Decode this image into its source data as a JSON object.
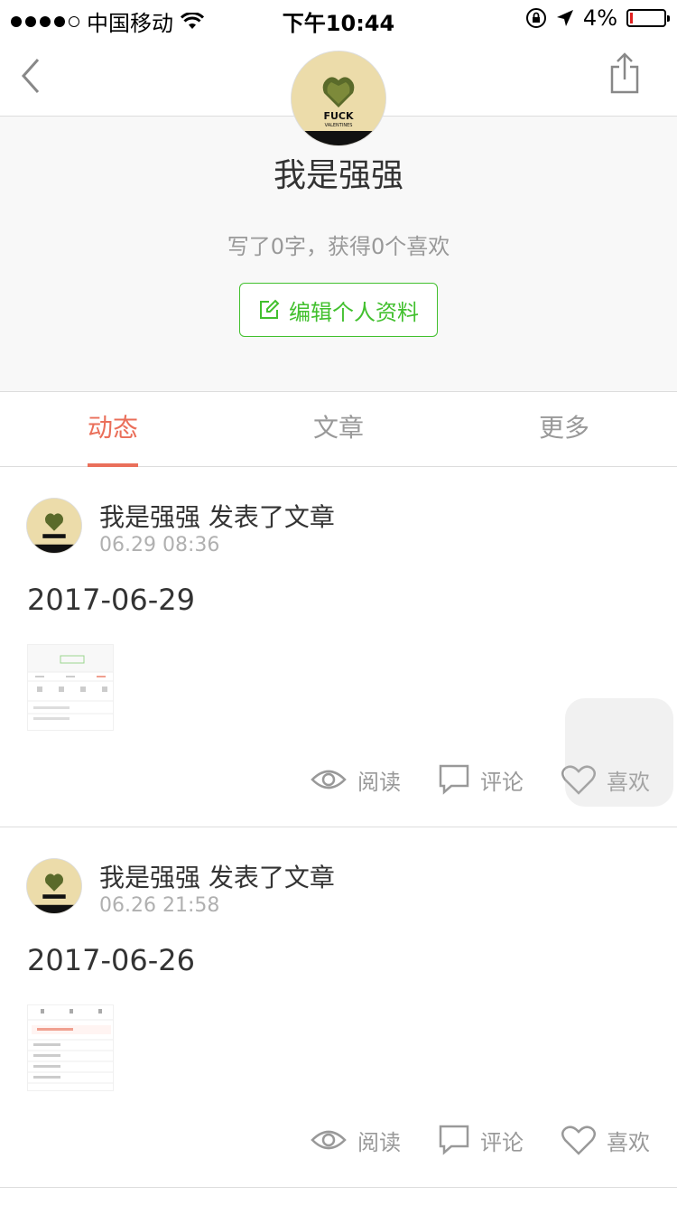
{
  "status_bar": {
    "carrier": "中国移动",
    "time": "下午10:44",
    "battery": "4%",
    "battery_level": 0.04,
    "icons": [
      "signal-icon",
      "wifi-icon",
      "rotation-lock-icon",
      "location-arrow-icon",
      "battery-icon"
    ]
  },
  "header": {
    "back_icon": "chevron-left-icon",
    "share_icon": "share-icon"
  },
  "profile": {
    "avatar_text_1": "FUCK",
    "avatar_text_2": "VALENTINES",
    "name": "我是强强",
    "stats": "写了0字，获得0个喜欢",
    "edit_label": "编辑个人资料",
    "edit_icon": "edit-icon"
  },
  "tabs": [
    {
      "label": "动态",
      "active": true
    },
    {
      "label": "文章",
      "active": false
    },
    {
      "label": "更多",
      "active": false
    }
  ],
  "feed": [
    {
      "user_line": "我是强强 发表了文章",
      "time": "06.29 08:36",
      "title": "2017-06-29",
      "actions": {
        "read": "阅读",
        "comment": "评论",
        "like": "喜欢"
      }
    },
    {
      "user_line": "我是强强 发表了文章",
      "time": "06.26 21:58",
      "title": "2017-06-26",
      "actions": {
        "read": "阅读",
        "comment": "评论",
        "like": "喜欢"
      }
    }
  ],
  "colors": {
    "accent": "#ea6f5a",
    "green": "#42c02e",
    "muted": "#999999"
  }
}
